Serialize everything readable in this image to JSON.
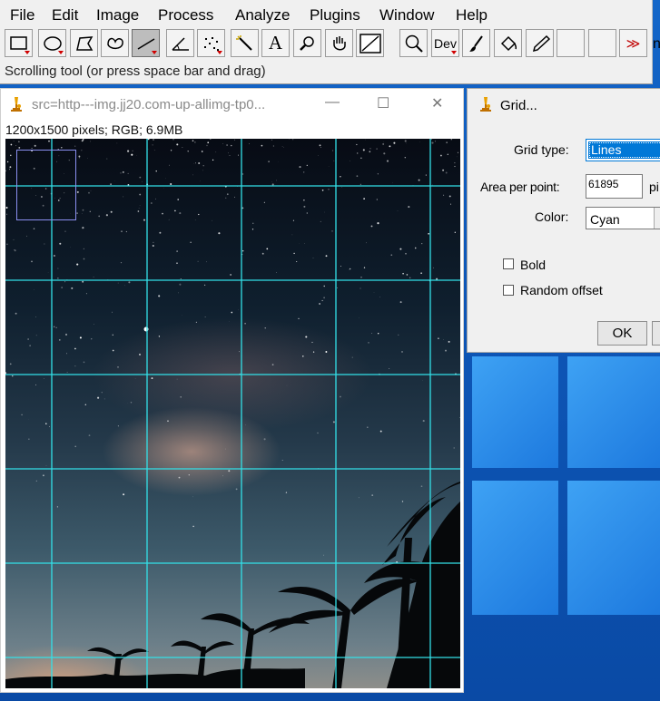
{
  "menu": [
    "File",
    "Edit",
    "Image",
    "Process",
    "Analyze",
    "Plugins",
    "Window",
    "Help"
  ],
  "toolbar": {
    "tools": [
      "rectangle-tool-icon",
      "oval-tool-icon",
      "polygon-tool-icon",
      "freehand-tool-icon",
      "line-tool-icon",
      "angle-tool-icon",
      "multipoint-tool-icon",
      "wand-tool-icon",
      "text-tool-icon",
      "magnifier-tool-icon",
      "scrolling-tool-icon",
      "color-picker-icon",
      "magnifying-glass-icon",
      "dev-menu-icon",
      "brush-tool-icon",
      "flood-fill-icon",
      "pencil-tool-icon"
    ],
    "text_tool_glyph": "A",
    "dev_label": "Dev",
    "more_label": "≫",
    "cut_letter": "n"
  },
  "status": "Scrolling tool (or press space bar and drag)",
  "image_window": {
    "title": "src=http---img.jj20.com-up-allimg-tp0...",
    "info": "1200x1500 pixels; RGB; 6.9MB",
    "minimize": "—",
    "maximize": "☐",
    "close": "✕",
    "grid_color": "#33e0e8"
  },
  "dialog": {
    "title": "Grid...",
    "grid_type_label": "Grid type:",
    "grid_type_value": "Lines",
    "area_label": "Area per point:",
    "area_value": "61895",
    "area_unit": "pi",
    "color_label": "Color:",
    "color_value": "Cyan",
    "bold_label": "Bold",
    "random_offset_label": "Random offset",
    "ok_label": "OK"
  },
  "colors": {
    "accent_select": "#0078d7",
    "desktop": "#0e57b8",
    "grid": "#33e0e8",
    "overview_box": "#8a8ff0"
  }
}
